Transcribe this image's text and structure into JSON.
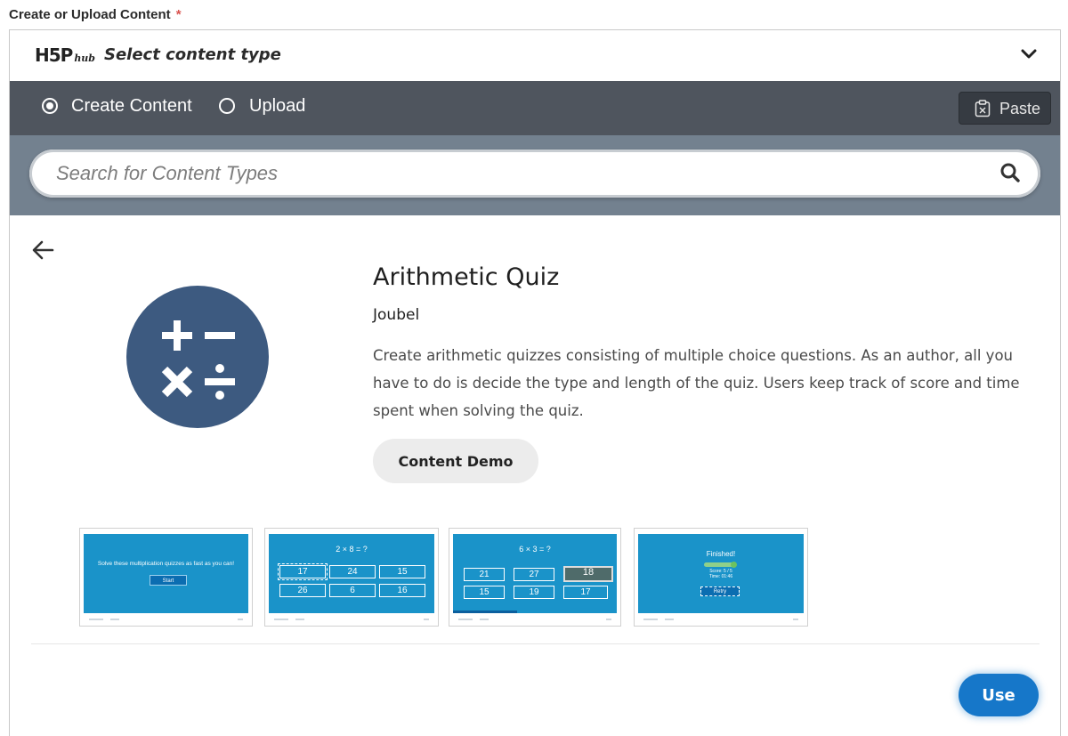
{
  "form": {
    "label": "Create or Upload Content",
    "required_mark": "*"
  },
  "header": {
    "logo_main": "H5P",
    "logo_sub": "hub",
    "title": "Select content type"
  },
  "tabs": [
    {
      "label": "Create Content",
      "selected": true
    },
    {
      "label": "Upload",
      "selected": false
    }
  ],
  "paste": {
    "label": "Paste"
  },
  "search": {
    "placeholder": "Search for Content Types"
  },
  "detail": {
    "title": "Arithmetic Quiz",
    "author": "Joubel",
    "description": "Create arithmetic quizzes consisting of multiple choice questions. As an author, all you have to do is decide the type and length of the quiz. Users keep track of score and time spent when solving the quiz.",
    "demo_label": "Content Demo",
    "icon": "arithmetic-operators-icon",
    "icon_color": "#3d5a80"
  },
  "screenshots": [
    {
      "message": "Solve these multiplication quizzes as fast as you can!",
      "button": "Start"
    },
    {
      "question": "2 × 8 = ?",
      "options": [
        "17",
        "24",
        "15",
        "26",
        "6",
        "16"
      ]
    },
    {
      "question": "6 × 3 = ?",
      "options": [
        "21",
        "27",
        "18",
        "15",
        "19",
        "17"
      ]
    },
    {
      "finished": "Finished!",
      "score": "Score: 5 / 5\nTime: 01:46",
      "button": "Retry"
    }
  ],
  "use": {
    "label": "Use"
  },
  "colors": {
    "tab_bar": "#4f555e",
    "search_band": "#73818f",
    "use_button": "#1677c9",
    "thumb_bg": "#1a93c9"
  }
}
